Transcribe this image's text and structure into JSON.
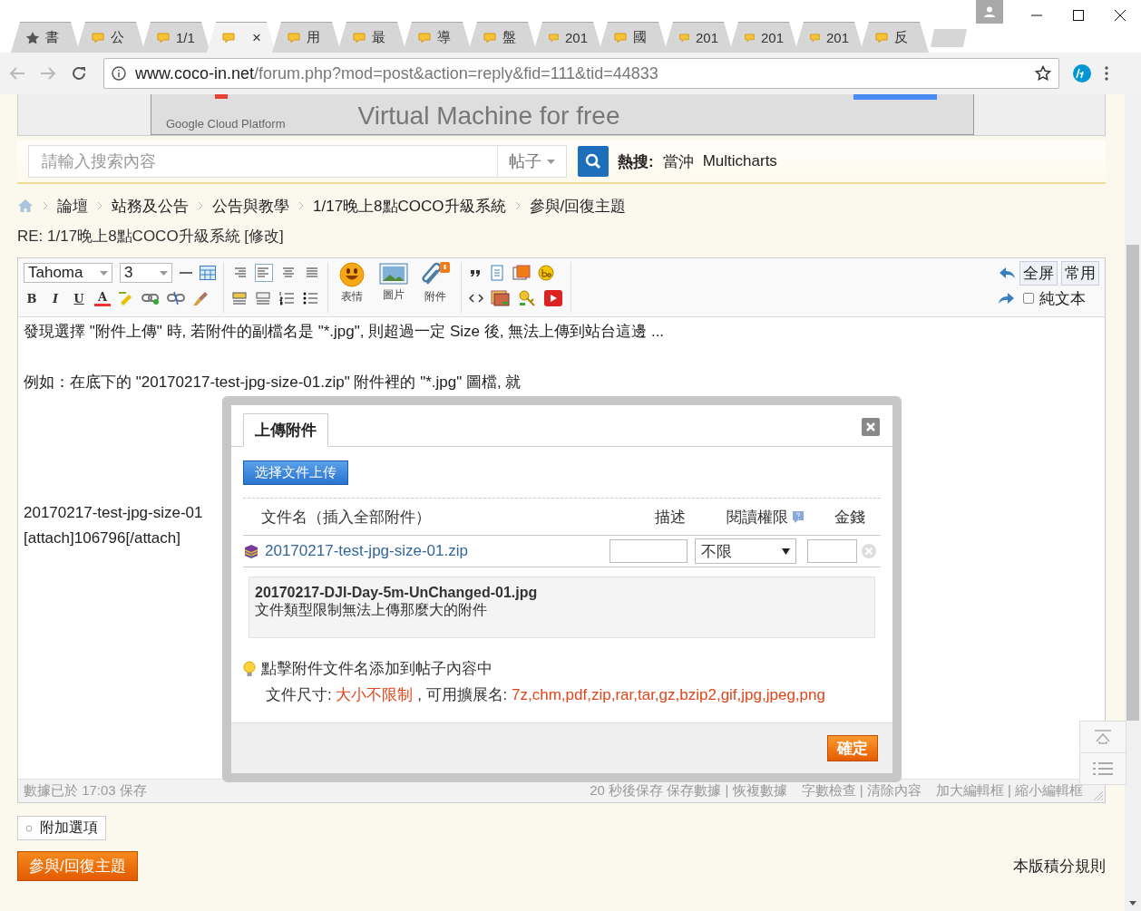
{
  "browser": {
    "tabs": [
      {
        "label": "書",
        "kind": "bookmark",
        "selected": false
      },
      {
        "label": "公",
        "kind": "page",
        "selected": false
      },
      {
        "label": "1/1",
        "kind": "page",
        "selected": false
      },
      {
        "close": "×",
        "kind": "page",
        "selected": true
      },
      {
        "label": "用",
        "kind": "page",
        "selected": false
      },
      {
        "label": "最",
        "kind": "page",
        "selected": false
      },
      {
        "label": "導",
        "kind": "page",
        "selected": false
      },
      {
        "label": "盤",
        "kind": "page",
        "selected": false
      },
      {
        "label": "201",
        "kind": "page",
        "selected": false
      },
      {
        "label": "國",
        "kind": "page",
        "selected": false
      },
      {
        "label": "201",
        "kind": "page",
        "selected": false
      },
      {
        "label": "201",
        "kind": "page",
        "selected": false
      },
      {
        "label": "201",
        "kind": "page",
        "selected": false
      },
      {
        "label": "反",
        "kind": "page",
        "selected": false
      }
    ],
    "address": {
      "host": "www.coco-in.net",
      "path": "/forum.php?mod=post&action=reply&fid=111&tid=44833"
    }
  },
  "banner": {
    "brand": "Google Cloud Platform",
    "headline": "Virtual Machine for free"
  },
  "search": {
    "placeholder": "請輸入搜索內容",
    "scope": "帖子",
    "hot_label": "熱搜:",
    "hot_terms": [
      "當沖",
      "Multicharts"
    ]
  },
  "breadcrumbs": [
    "論壇",
    "站務及公告",
    "公告與教學",
    "1/17晚上8點COCO升級系統",
    "參與/回復主題"
  ],
  "post_title": "RE: 1/17晚上8點COCO升級系統 [修改]",
  "editor": {
    "font": "Tahoma",
    "size": "3",
    "format_buttons": [
      "B",
      "I",
      "U",
      "A"
    ],
    "media_buttons": [
      "表情",
      "圖片",
      "附件"
    ],
    "right_buttons": [
      "全屏",
      "常用"
    ],
    "plain_text": {
      "label": "純文本",
      "checked": false
    },
    "blocks": [
      {
        "lines": [
          "發現選擇 \"附件上傳\" 時, 若附件的副檔名是 \"*.jpg\", 則超過一定 Size 後, 無法上傳到站台這邊 ..."
        ]
      },
      {
        "lines": [
          "例如：在底下的 \"20170217-test-jpg-size-01.zip\" 附件裡的 \"*.jpg\" 圖檔, 就"
        ]
      },
      {
        "lines": [
          "20170217-test-jpg-size-01",
          "[attach]106796[/attach]"
        ]
      }
    ],
    "status_left": "數據已於 17:03 保存",
    "status_right": [
      "20 秒後保存 保存數據 | 恢複數據",
      "字數檢查 | 清除內容",
      "加大編輯框 | 縮小編輯框"
    ]
  },
  "dialog": {
    "tab": "上傳附件",
    "upload_button": "选择文件上传",
    "columns": [
      "文件名（插入全部附件）",
      "描述",
      "閱讀權限",
      "金錢"
    ],
    "files": [
      {
        "name": "20170217-test-jpg-size-01.zip",
        "permission": "不限"
      }
    ],
    "error": {
      "file": "20170217-DJI-Day-5m-UnChanged-01.jpg",
      "message": "文件類型限制無法上傳那麼大的附件"
    },
    "tip": "點擊附件文件名添加到帖子內容中",
    "size_label": "文件尺寸:",
    "size_value": "大小不限制",
    "ext_label": ", 可用擴展名:",
    "ext_value": "7z,chm,pdf,zip,rar,tar,gz,bzip2,gif,jpg,jpeg,png",
    "ok_button": "確定"
  },
  "footer": {
    "options_button": "附加選項",
    "submit_button": "參與/回復主題",
    "rules_link": "本版積分規則"
  }
}
